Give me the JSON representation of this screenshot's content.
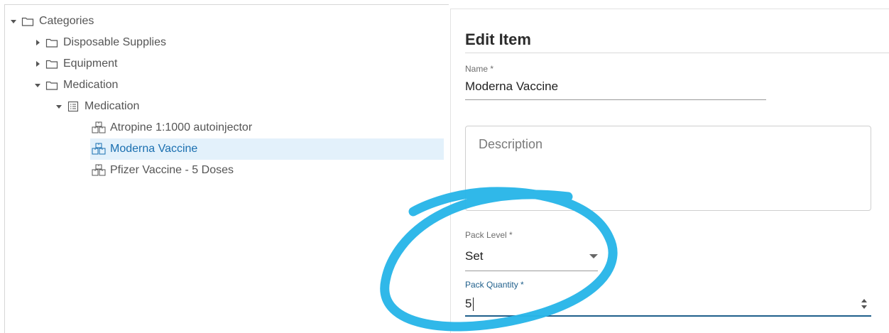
{
  "tree": {
    "items": [
      {
        "label": "Categories",
        "icon": "folder-icon",
        "expanded": true
      },
      {
        "label": "Disposable Supplies",
        "icon": "folder-icon",
        "expanded": false
      },
      {
        "label": "Equipment",
        "icon": "folder-icon",
        "expanded": false
      },
      {
        "label": "Medication",
        "icon": "folder-icon",
        "expanded": true
      },
      {
        "label": "Medication",
        "icon": "list-icon",
        "expanded": true
      },
      {
        "label": "Atropine 1:1000 autoinjector",
        "icon": "package-icon"
      },
      {
        "label": "Moderna Vaccine",
        "icon": "package-icon",
        "selected": true
      },
      {
        "label": "Pfizer Vaccine - 5 Doses",
        "icon": "package-icon"
      }
    ]
  },
  "form": {
    "title": "Edit Item",
    "name_label": "Name *",
    "name_value": "Moderna Vaccine",
    "description_placeholder": "Description",
    "pack_level_label": "Pack Level *",
    "pack_level_value": "Set",
    "pack_quantity_label": "Pack Quantity *",
    "pack_quantity_value": "5"
  },
  "colors": {
    "selected_bg": "#e3f1fb",
    "selected_text": "#1a6fb0",
    "focus_accent": "#1f5f8b",
    "annotation": "#29b6e8"
  }
}
